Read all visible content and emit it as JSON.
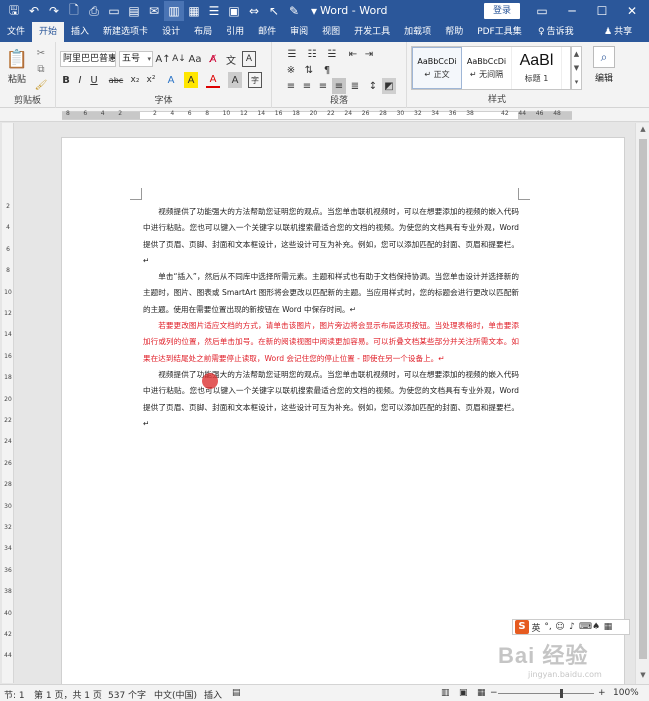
{
  "window": {
    "title": "Word - Word",
    "login_label": "登录",
    "controls": {
      "ribbon_options": "▭",
      "minimize": "─",
      "maximize": "☐",
      "close": "✕"
    }
  },
  "qat": {
    "icons": [
      "save-icon",
      "undo-icon",
      "redo-icon",
      "print-preview-icon",
      "quick-print-icon",
      "open-icon",
      "new-doc-icon",
      "email-icon",
      "read-mode-icon",
      "table-icon",
      "numbering-icon",
      "frame-icon",
      "spacing-icon",
      "select-icon",
      "drawing-icon",
      "customize-icon"
    ]
  },
  "tabs": [
    "文件",
    "开始",
    "插入",
    "新建选项卡",
    "设计",
    "布局",
    "引用",
    "邮件",
    "审阅",
    "视图",
    "开发工具",
    "加载项",
    "帮助",
    "PDF工具集"
  ],
  "selected_tab": "开始",
  "tell_me": "告诉我",
  "share": "共享",
  "ribbon": {
    "clipboard": {
      "paste_label": "粘贴",
      "group_label": "剪贴板"
    },
    "font": {
      "font_name": "阿里巴巴普惠",
      "font_size": "五号",
      "group_label": "字体",
      "buttons": [
        "B",
        "I",
        "U",
        "abc",
        "x₂",
        "x²",
        "A",
        "A",
        "A",
        "A"
      ]
    },
    "paragraph": {
      "group_label": "段落"
    },
    "styles": {
      "group_label": "样式",
      "items": [
        {
          "sample": "AaBbCcDi",
          "name": "↵ 正文"
        },
        {
          "sample": "AaBbCcDi",
          "name": "↵ 无间隔"
        },
        {
          "sample": "AaBl",
          "name": "标题 1"
        }
      ]
    },
    "editing": {
      "label": "编辑"
    }
  },
  "ruler": {
    "h_numbers": [
      "8",
      "6",
      "4",
      "2",
      "",
      "2",
      "4",
      "6",
      "8",
      "10",
      "12",
      "14",
      "16",
      "18",
      "20",
      "22",
      "24",
      "26",
      "28",
      "30",
      "32",
      "34",
      "36",
      "38",
      "",
      "42",
      "44",
      "46",
      "48"
    ],
    "v_numbers": [
      "2",
      "4",
      "6",
      "8",
      "10",
      "12",
      "14",
      "16",
      "18",
      "20",
      "22",
      "24",
      "26",
      "28",
      "30",
      "32",
      "34",
      "36",
      "38",
      "40",
      "42",
      "44"
    ]
  },
  "document": {
    "paragraphs": [
      {
        "text": "视频提供了功能强大的方法帮助您证明您的观点。当您单击联机视频时，可以在想要添加的视频的嵌入代码中进行粘贴。您也可以键入一个关键字以联机搜索最适合您的文档的视频。为使您的文档具有专业外观，Word 提供了页眉、页脚、封面和文本框设计，这些设计可互为补充。例如，您可以添加匹配的封面、页眉和提要栏。↵",
        "color": "normal"
      },
      {
        "text": "单击“插入”，然后从不同库中选择所需元素。主题和样式也有助于文档保持协调。当您单击设计并选择新的主题时，图片、图表或 SmartArt 图形将会更改以匹配新的主题。当应用样式时，您的标题会进行更改以匹配新的主题。使用在需要位置出现的新按钮在 Word 中保存时间。↵",
        "color": "normal"
      },
      {
        "text": "若要更改图片适应文档的方式，请单击该图片，图片旁边将会显示布局选项按钮。当处理表格时，单击要添加行或列的位置，然后单击加号。在新的阅读视图中阅读更加容易。可以折叠文档某些部分并关注所需文本。如果在达到结尾处之前需要停止读取，Word 会记住您的停止位置 - 即使在另一个设备上。↵",
        "color": "red"
      },
      {
        "text": "视频提供了功能强大的方法帮助您证明您的观点。当您单击联机视频时，可以在想要添加的视频的嵌入代码中进行粘贴。您也可以键入一个关键字以联机搜索最适合您的文档的视频。为使您的文档具有专业外观，Word 提供了页眉、页脚、封面和文本框设计，这些设计可互为补充。例如，您可以添加匹配的封面、页眉和提要栏。↵",
        "color": "normal"
      }
    ],
    "red_color": "#e0202a"
  },
  "ime": {
    "lang": "英"
  },
  "watermark": {
    "text": "Bai 经验",
    "sub": "jingyan.baidu.com"
  },
  "status": {
    "section": "节: 1",
    "page": "第 1 页，共 1 页",
    "words": "537 个字",
    "language": "中文(中国)",
    "mode": "插入",
    "zoom_minus": "−",
    "zoom_plus": "+",
    "zoom": "100%"
  },
  "colors": {
    "accent": "#2b579a",
    "ribbon_bg": "#f3f3f3"
  }
}
